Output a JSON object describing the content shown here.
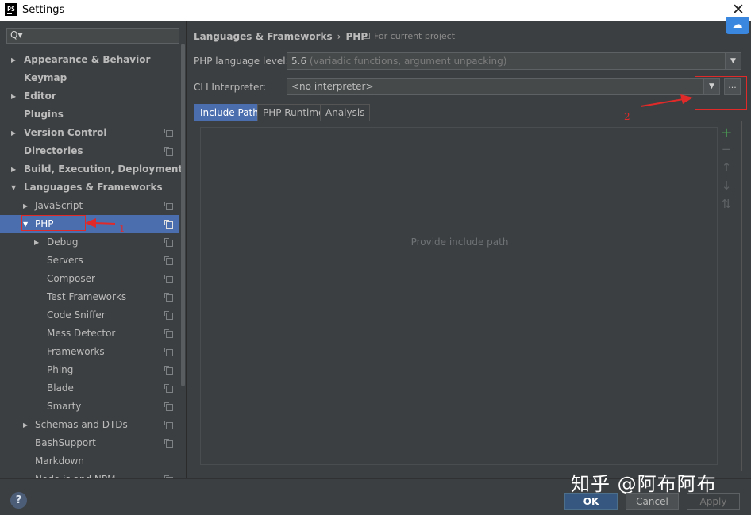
{
  "window": {
    "title": "Settings",
    "app_icon_label": "PS",
    "close_glyph": "✕"
  },
  "search": {
    "glyph": "Q▾",
    "value": ""
  },
  "tree": [
    {
      "label": "Appearance & Behavior",
      "level": 0,
      "arrow": "▶",
      "bold": true,
      "proj": false
    },
    {
      "label": "Keymap",
      "level": 0,
      "arrow": "",
      "bold": true,
      "proj": false
    },
    {
      "label": "Editor",
      "level": 0,
      "arrow": "▶",
      "bold": true,
      "proj": false
    },
    {
      "label": "Plugins",
      "level": 0,
      "arrow": "",
      "bold": true,
      "proj": false
    },
    {
      "label": "Version Control",
      "level": 0,
      "arrow": "▶",
      "bold": true,
      "proj": true
    },
    {
      "label": "Directories",
      "level": 0,
      "arrow": "",
      "bold": true,
      "proj": true
    },
    {
      "label": "Build, Execution, Deployment",
      "level": 0,
      "arrow": "▶",
      "bold": true,
      "proj": false
    },
    {
      "label": "Languages & Frameworks",
      "level": 0,
      "arrow": "▼",
      "bold": true,
      "proj": false
    },
    {
      "label": "JavaScript",
      "level": 1,
      "arrow": "▶",
      "bold": false,
      "proj": true
    },
    {
      "label": "PHP",
      "level": 1,
      "arrow": "▼",
      "bold": false,
      "proj": true,
      "selected": true
    },
    {
      "label": "Debug",
      "level": 2,
      "arrow": "▶",
      "bold": false,
      "proj": true
    },
    {
      "label": "Servers",
      "level": 2,
      "arrow": "",
      "bold": false,
      "proj": true
    },
    {
      "label": "Composer",
      "level": 2,
      "arrow": "",
      "bold": false,
      "proj": true
    },
    {
      "label": "Test Frameworks",
      "level": 2,
      "arrow": "",
      "bold": false,
      "proj": true
    },
    {
      "label": "Code Sniffer",
      "level": 2,
      "arrow": "",
      "bold": false,
      "proj": true
    },
    {
      "label": "Mess Detector",
      "level": 2,
      "arrow": "",
      "bold": false,
      "proj": true
    },
    {
      "label": "Frameworks",
      "level": 2,
      "arrow": "",
      "bold": false,
      "proj": true
    },
    {
      "label": "Phing",
      "level": 2,
      "arrow": "",
      "bold": false,
      "proj": true
    },
    {
      "label": "Blade",
      "level": 2,
      "arrow": "",
      "bold": false,
      "proj": true
    },
    {
      "label": "Smarty",
      "level": 2,
      "arrow": "",
      "bold": false,
      "proj": true
    },
    {
      "label": "Schemas and DTDs",
      "level": 1,
      "arrow": "▶",
      "bold": false,
      "proj": true
    },
    {
      "label": "BashSupport",
      "level": 1,
      "arrow": "",
      "bold": false,
      "proj": true
    },
    {
      "label": "Markdown",
      "level": 1,
      "arrow": "",
      "bold": false,
      "proj": false
    },
    {
      "label": "Node.js and NPM",
      "level": 1,
      "arrow": "",
      "bold": false,
      "proj": true
    }
  ],
  "breadcrumb": {
    "parent": "Languages & Frameworks",
    "separator": "›",
    "current": "PHP"
  },
  "scope_note": "For current project",
  "baidu_icon_glyph": "☁",
  "php_level": {
    "label": "PHP language level:",
    "value": "5.6",
    "hint": "(variadic functions, argument unpacking)"
  },
  "cli": {
    "label": "CLI Interpreter:",
    "value": "<no interpreter>",
    "dots": "..."
  },
  "dropdown_glyph": "▼",
  "tabs": [
    {
      "label": "Include Path",
      "active": true
    },
    {
      "label": "PHP Runtime",
      "active": false
    },
    {
      "label": "Analysis",
      "active": false
    }
  ],
  "include_path": {
    "empty_text": "Provide include path"
  },
  "tools": {
    "add": "+",
    "remove": "−",
    "up": "↑",
    "down": "↓",
    "sort": "⇅"
  },
  "annotations": {
    "one": "1",
    "two": "2",
    "color": "#e02a2a"
  },
  "footer": {
    "help": "?",
    "ok": "OK",
    "cancel": "Cancel",
    "apply": "Apply"
  },
  "watermark": "知乎 @阿布阿布",
  "colors": {
    "selection": "#4b6eaf",
    "background": "#3c3f41",
    "primary_button": "#365880"
  }
}
